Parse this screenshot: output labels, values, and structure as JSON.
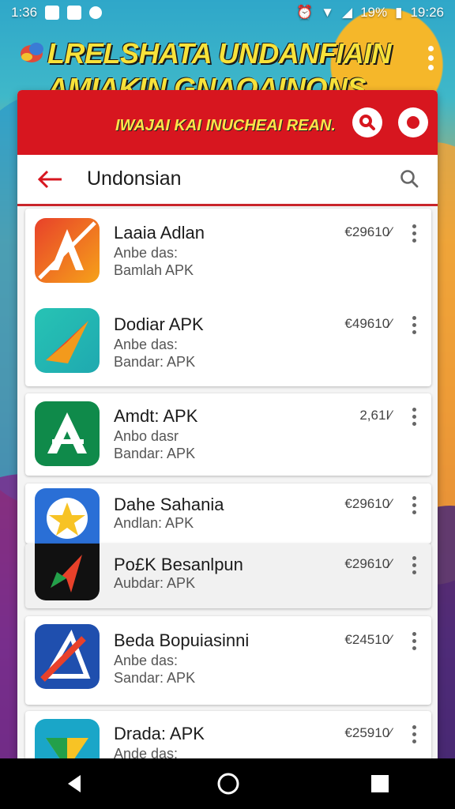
{
  "status_bar": {
    "time": "1:36",
    "battery": "19%",
    "clock_right": "19:26"
  },
  "banner": {
    "title_line1": "LRELSHATA UNDANFIAIN",
    "title_line2": "AMIAKIN GNAOAINONS"
  },
  "panel": {
    "subtitle": "IWAJAI KAI INUCHEAI REAN.",
    "search_title": "Undonsian"
  },
  "apps": [
    {
      "name": "Laaia Adlan",
      "line1": "Anbe das:",
      "line2": "Bamlah APK",
      "size": "€29610⁄",
      "icon": "app-icon-red-orange",
      "color1": "#e8412a",
      "color2": "#f6a21a"
    },
    {
      "name": "Dodiar APK",
      "line1": "Anbe das:",
      "line2": "Bandar: APK",
      "size": "€49610⁄",
      "icon": "app-icon-teal-arrow",
      "color1": "#27c3b4",
      "color2": "#f39a1c"
    },
    {
      "name": "Amdt: APK",
      "line1": "Anbo dasr",
      "line2": "Bandar: APK",
      "size": "2,61I⁄",
      "icon": "app-icon-green-a",
      "color1": "#0f8a4a",
      "color2": "#ffffff"
    },
    {
      "name": "Dahe Sahania",
      "line1": "Andlan: APK",
      "line2": "",
      "size": "€29610⁄",
      "icon": "app-icon-blue-star",
      "color1": "#2a6fd6",
      "color2": "#f7c325"
    },
    {
      "name": "Po£K Besanlpun",
      "line1": "Aubdar: APK",
      "line2": "",
      "size": "€29610⁄",
      "icon": "app-icon-black-arrow",
      "color1": "#111111",
      "color2": "#e8412a"
    },
    {
      "name": "Beda Bopuiasinni",
      "line1": "Anbe das:",
      "line2": "Sandar: APK",
      "size": "€24510⁄",
      "icon": "app-icon-blue-a",
      "color1": "#1f4fae",
      "color2": "#e8412a"
    },
    {
      "name": "Drada: APK",
      "line1": "Ande das:",
      "line2": "",
      "size": "€25910⁄",
      "icon": "app-icon-teal-green",
      "color1": "#1aa6c8",
      "color2": "#f7c325"
    }
  ],
  "colors": {
    "header_red": "#d7161f",
    "banner_yellow": "#f7e23a"
  }
}
